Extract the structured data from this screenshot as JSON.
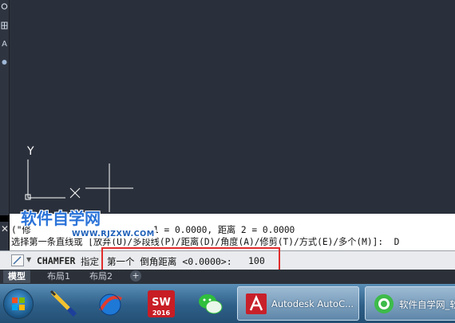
{
  "left_palette": {
    "icons": [
      "zoom-icon",
      "grid-icon",
      "text-icon",
      "attribute-icon"
    ],
    "text_tool_glyph": "A"
  },
  "history": {
    "line1_left": "(\"修",
    "line1_right": "1 = 0.0000, 距离 2 = 0.0000",
    "line2": "选择第一条直线或 [放弃(U)/多段线(P)/距离(D)/角度(A)/修剪(T)/方式(E)/多个(M)]:  D"
  },
  "watermark": {
    "title": "软件自学网",
    "url": "WWW.RJZXW.COM"
  },
  "command_line": {
    "command": "CHAMFER",
    "label": "指定",
    "prompt": "第一个 倒角距离 <0.0000>: ",
    "value": "100",
    "highlight_color": "#e12d2d"
  },
  "layout_tabs": [
    {
      "label": "模型",
      "active": true
    },
    {
      "label": "布局1",
      "active": false
    },
    {
      "label": "布局2",
      "active": false
    }
  ],
  "ucs": {
    "y_label": "Y"
  },
  "taskbar": {
    "pinned": [
      "windows-start",
      "pen-tool-app",
      "globe-app",
      "solidworks-2016",
      "wechat"
    ],
    "sw_badge": "SW",
    "sw_year": "2016",
    "tasks": [
      {
        "label": "Autodesk AutoC...",
        "icon": "autocad-icon"
      },
      {
        "label": "软件自学网_软",
        "icon": "browser-icon"
      }
    ]
  },
  "colors": {
    "canvas": "#2a303b",
    "crosshair": "#ffffff",
    "accent_red": "#e12d2d",
    "watermark_blue": "#2a73d8"
  }
}
